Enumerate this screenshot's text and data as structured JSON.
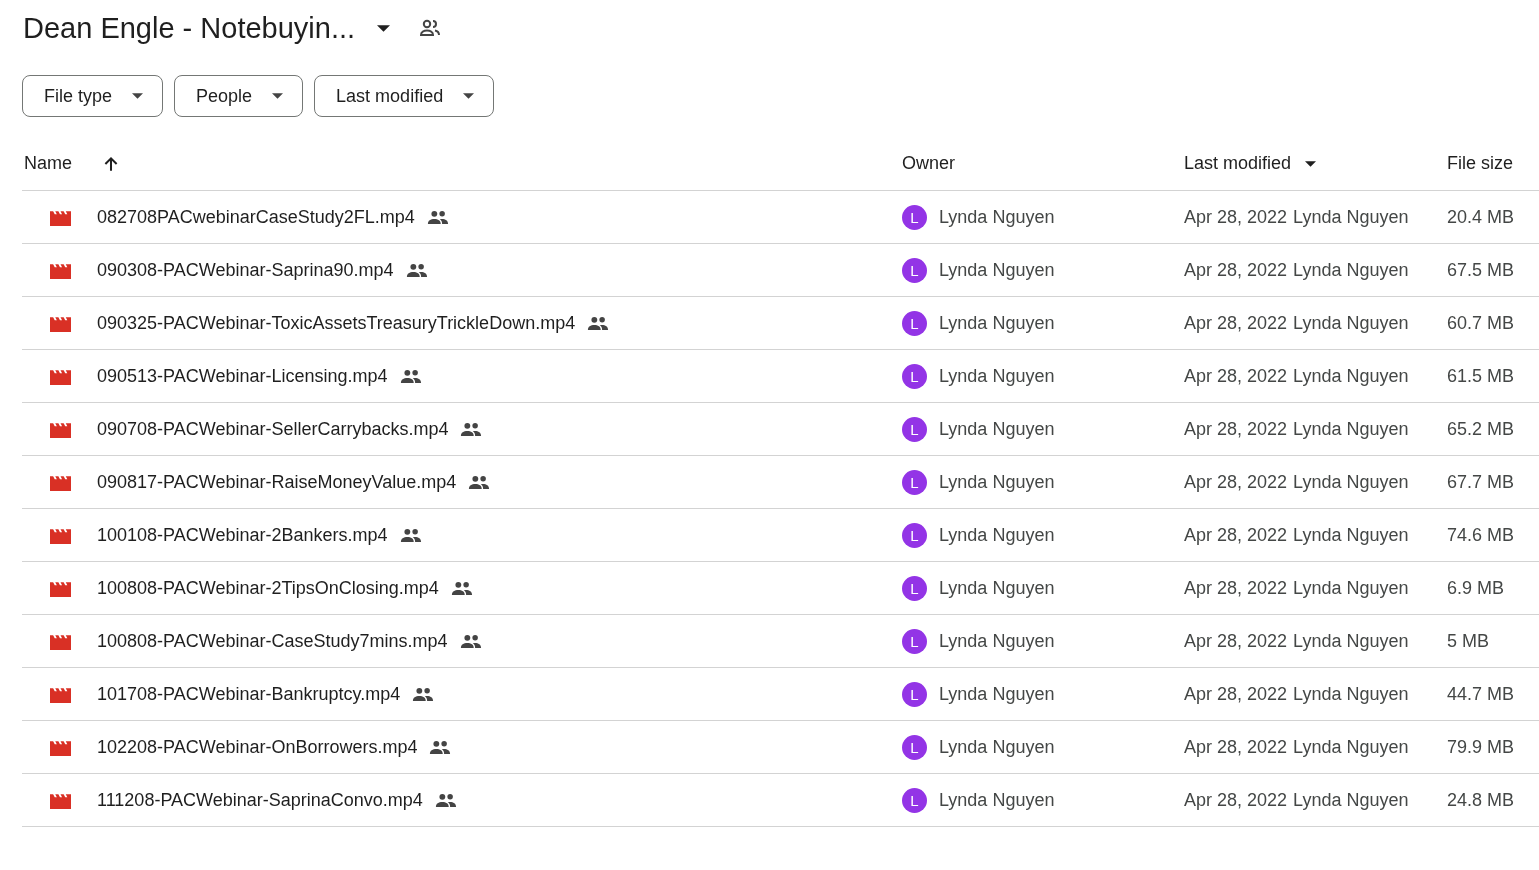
{
  "folder": {
    "title": "Dean Engle - Notebuyin...",
    "shared": true
  },
  "filters": [
    "File type",
    "People",
    "Last modified"
  ],
  "table": {
    "columns": [
      {
        "label": "Name",
        "sort_ascending": true,
        "sort_descending": false
      },
      {
        "label": "Owner",
        "sort_ascending": false,
        "sort_descending": false
      },
      {
        "label": "Last modified",
        "sort_ascending": false,
        "sort_descending": true
      },
      {
        "label": "File size",
        "sort_ascending": false,
        "sort_descending": false
      }
    ],
    "rows": [
      {
        "name": "082708PACwebinarCaseStudy2FL.mp4",
        "shared": true,
        "owner_initial": "L",
        "owner": "Lynda Nguyen",
        "modified": "Apr 28, 2022",
        "modified_by": "Lynda Nguyen",
        "size": "20.4 MB"
      },
      {
        "name": "090308-PACWebinar-Saprina90.mp4",
        "shared": true,
        "owner_initial": "L",
        "owner": "Lynda Nguyen",
        "modified": "Apr 28, 2022",
        "modified_by": "Lynda Nguyen",
        "size": "67.5 MB"
      },
      {
        "name": "090325-PACWebinar-ToxicAssetsTreasuryTrickleDown.mp4",
        "shared": true,
        "owner_initial": "L",
        "owner": "Lynda Nguyen",
        "modified": "Apr 28, 2022",
        "modified_by": "Lynda Nguyen",
        "size": "60.7 MB"
      },
      {
        "name": "090513-PACWebinar-Licensing.mp4",
        "shared": true,
        "owner_initial": "L",
        "owner": "Lynda Nguyen",
        "modified": "Apr 28, 2022",
        "modified_by": "Lynda Nguyen",
        "size": "61.5 MB"
      },
      {
        "name": "090708-PACWebinar-SellerCarrybacks.mp4",
        "shared": true,
        "owner_initial": "L",
        "owner": "Lynda Nguyen",
        "modified": "Apr 28, 2022",
        "modified_by": "Lynda Nguyen",
        "size": "65.2 MB"
      },
      {
        "name": "090817-PACWebinar-RaiseMoneyValue.mp4",
        "shared": true,
        "owner_initial": "L",
        "owner": "Lynda Nguyen",
        "modified": "Apr 28, 2022",
        "modified_by": "Lynda Nguyen",
        "size": "67.7 MB"
      },
      {
        "name": "100108-PACWebinar-2Bankers.mp4",
        "shared": true,
        "owner_initial": "L",
        "owner": "Lynda Nguyen",
        "modified": "Apr 28, 2022",
        "modified_by": "Lynda Nguyen",
        "size": "74.6 MB"
      },
      {
        "name": "100808-PACWebinar-2TipsOnClosing.mp4",
        "shared": true,
        "owner_initial": "L",
        "owner": "Lynda Nguyen",
        "modified": "Apr 28, 2022",
        "modified_by": "Lynda Nguyen",
        "size": "6.9 MB"
      },
      {
        "name": "100808-PACWebinar-CaseStudy7mins.mp4",
        "shared": true,
        "owner_initial": "L",
        "owner": "Lynda Nguyen",
        "modified": "Apr 28, 2022",
        "modified_by": "Lynda Nguyen",
        "size": "5 MB"
      },
      {
        "name": "101708-PACWebinar-Bankruptcy.mp4",
        "shared": true,
        "owner_initial": "L",
        "owner": "Lynda Nguyen",
        "modified": "Apr 28, 2022",
        "modified_by": "Lynda Nguyen",
        "size": "44.7 MB"
      },
      {
        "name": "102208-PACWebinar-OnBorrowers.mp4",
        "shared": true,
        "owner_initial": "L",
        "owner": "Lynda Nguyen",
        "modified": "Apr 28, 2022",
        "modified_by": "Lynda Nguyen",
        "size": "79.9 MB"
      },
      {
        "name": "111208-PACWebinar-SaprinaConvo.mp4",
        "shared": true,
        "owner_initial": "L",
        "owner": "Lynda Nguyen",
        "modified": "Apr 28, 2022",
        "modified_by": "Lynda Nguyen",
        "size": "24.8 MB"
      }
    ]
  }
}
